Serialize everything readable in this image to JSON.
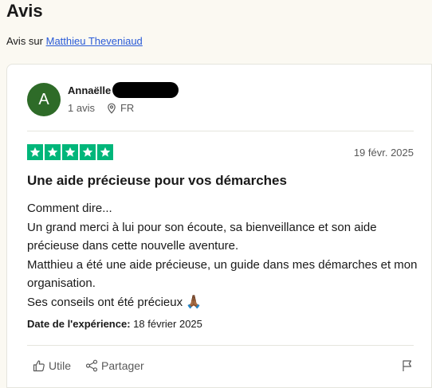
{
  "page": {
    "title": "Avis"
  },
  "subline": {
    "prefix": "Avis sur ",
    "link": "Matthieu Theveniaud"
  },
  "review": {
    "avatar_letter": "A",
    "reviewer_name": "Annaëlle",
    "review_count": "1 avis",
    "country": "FR",
    "rating": 5,
    "date": "19 févr. 2025",
    "title": "Une aide précieuse pour vos démarches",
    "body_lines": [
      "Comment dire...",
      "Un grand merci à lui pour son écoute, sa bienveillance et son aide précieuse dans cette nouvelle aventure.",
      "Matthieu a été une aide précieuse, un guide dans mes démarches et mon organisation.",
      "Ses conseils ont été précieux"
    ],
    "emoji": "🙏🏾",
    "experience_label": "Date de l'expérience:",
    "experience_date": "18 février 2025",
    "useful_label": "Utile",
    "share_label": "Partager"
  },
  "colors": {
    "star": "#00b67a",
    "avatar": "#2e6b28",
    "link": "#2a5bd7"
  },
  "icons": [
    "location-pin-icon",
    "star-icon",
    "thumbs-up-icon",
    "share-icon",
    "flag-icon"
  ]
}
